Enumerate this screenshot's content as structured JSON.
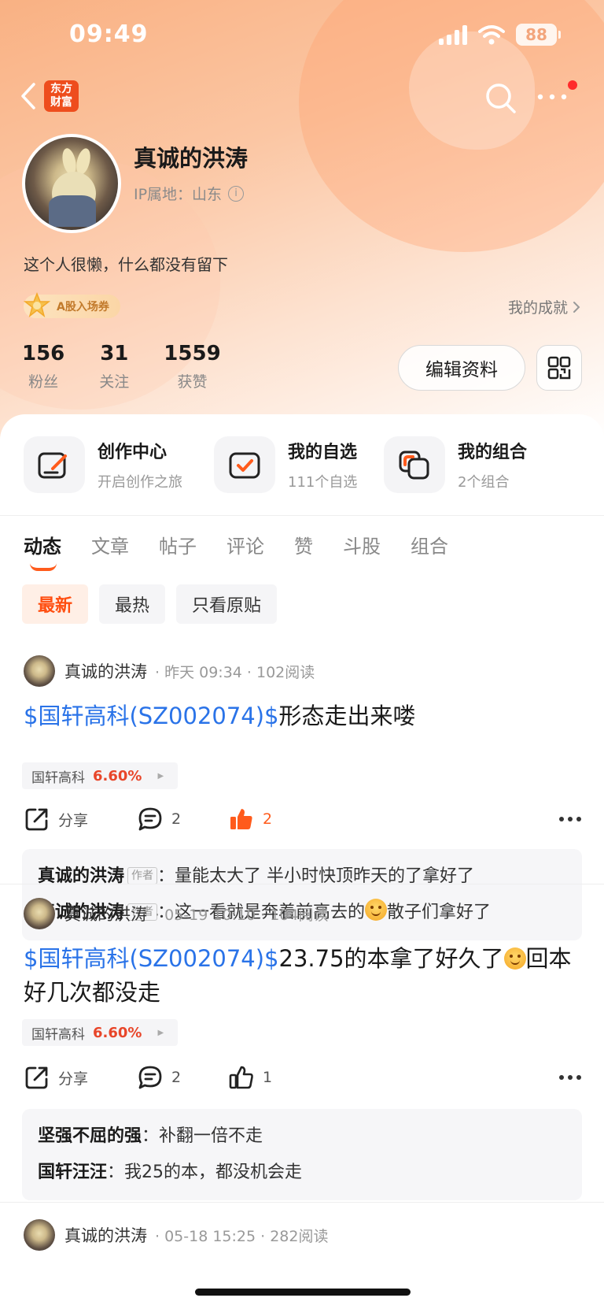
{
  "status_bar": {
    "time": "09:49",
    "battery": "88"
  },
  "nav": {
    "app_logo_line1": "东方",
    "app_logo_line2": "财富"
  },
  "profile": {
    "name": "真诚的洪涛",
    "ip": "IP属地：山东",
    "bio": "这个人很懒，什么都没有留下",
    "badge": "A股入场券",
    "achievement": "我的成就",
    "stats": [
      {
        "value": "156",
        "label": "粉丝"
      },
      {
        "value": "31",
        "label": "关注"
      },
      {
        "value": "1559",
        "label": "获赞"
      }
    ],
    "edit_button": "编辑资料"
  },
  "features": [
    {
      "title": "创作中心",
      "subtitle": "开启创作之旅",
      "icon": "pencil-icon"
    },
    {
      "title": "我的自选",
      "subtitle": "111个自选",
      "icon": "checkbox-icon"
    },
    {
      "title": "我的组合",
      "subtitle": "2个组合",
      "icon": "portfolio-icon"
    }
  ],
  "tabs": [
    "动态",
    "文章",
    "帖子",
    "评论",
    "赞",
    "斗股",
    "组合"
  ],
  "filters": [
    "最新",
    "最热",
    "只看原贴"
  ],
  "posts": [
    {
      "author": "真诚的洪涛",
      "meta": "· 昨天 09:34 · 102阅读",
      "stock": "$国轩高科(SZ002074)$",
      "text": "形态走出来喽",
      "tag_name": "国轩高科",
      "tag_pct": "6.60%",
      "share": "分享",
      "comments": "2",
      "likes": "2",
      "comment_list": [
        {
          "author": "真诚的洪涛",
          "tag": "作者",
          "text": "量能太大了 半小时快顶昨天的了拿好了"
        },
        {
          "author": "真诚的洪涛",
          "tag": "作者",
          "text_before": "这一看就是奔着前高去的",
          "text_after": "散子们拿好了"
        }
      ]
    },
    {
      "author": "真诚的洪涛",
      "meta": "· 05-19 10:10 · 104阅读",
      "stock": "$国轩高科(SZ002074)$",
      "text_before": "23.75的本拿了好久了",
      "text_after": "回本好几次都没走",
      "tag_name": "国轩高科",
      "tag_pct": "6.60%",
      "share": "分享",
      "comments": "2",
      "likes": "1",
      "comment_list": [
        {
          "author": "坚强不屈的强",
          "text": "补翻一倍不走"
        },
        {
          "author": "国轩汪汪",
          "text": "我25的本，都没机会走"
        }
      ]
    },
    {
      "author": "真诚的洪涛",
      "meta": "· 05-18 15:25 · 282阅读"
    }
  ],
  "colors": {
    "accent": "#ff5b1c",
    "link": "#2a73e8",
    "rise": "#e8462a"
  }
}
